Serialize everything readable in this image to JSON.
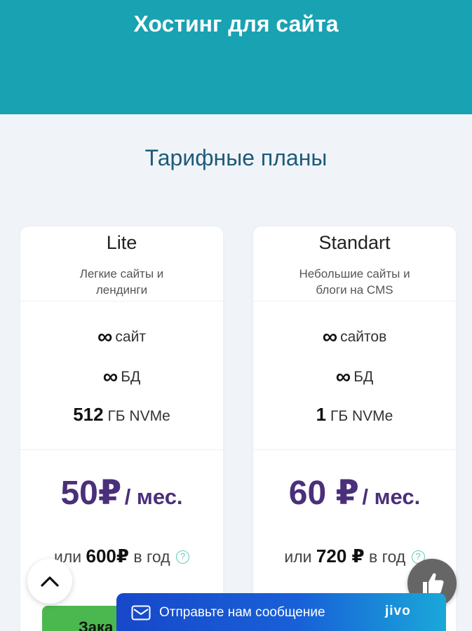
{
  "hero": {
    "title": "Хостинг для сайта"
  },
  "section": {
    "title": "Тарифные планы"
  },
  "plans": [
    {
      "name": "Lite",
      "desc_line1": "Легкие сайты и",
      "desc_line2": "лендинги",
      "sites_symbol": "∞",
      "sites_label": "сайт",
      "db_symbol": "∞",
      "db_label": "БД",
      "disk_value": "512",
      "disk_unit": "ГБ NVMe",
      "price": "50₽",
      "price_period": "/ мес.",
      "yearly_prefix": "или",
      "yearly_value": "600₽",
      "yearly_suffix": "в год",
      "order_label": "Зака"
    },
    {
      "name": "Standart",
      "desc_line1": "Небольшие сайты и",
      "desc_line2": "блоги на CMS",
      "sites_symbol": "∞",
      "sites_label": "сайтов",
      "db_symbol": "∞",
      "db_label": "БД",
      "disk_value": "1",
      "disk_unit": "ГБ NVMe",
      "price": "60 ₽",
      "price_period": "/ мес.",
      "yearly_prefix": "или",
      "yearly_value": "720 ₽",
      "yearly_suffix": "в год"
    }
  ],
  "help_icon_glyph": "?",
  "chat": {
    "label": "Отправьте нам сообщение",
    "brand": "jivo",
    "gradient_start": "#1748c9",
    "gradient_end": "#1aa8d8"
  },
  "colors": {
    "hero_bg": "#18a2b2",
    "price": "#4a2f7a",
    "order_button": "#4bb84f",
    "section_title": "#1f5a78"
  },
  "icons": {
    "scroll_up": "chevron-up-icon",
    "like": "thumbs-up-icon",
    "chat": "mail-icon",
    "help": "question-circle-icon"
  }
}
